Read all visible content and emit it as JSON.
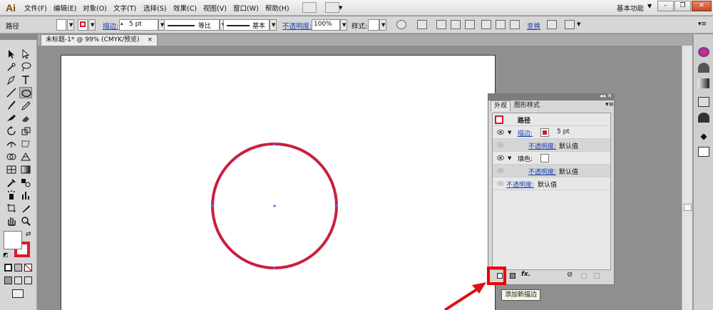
{
  "app": {
    "logo": "Ai"
  },
  "menu": [
    "文件(F)",
    "编辑(E)",
    "对象(O)",
    "文字(T)",
    "选择(S)",
    "效果(C)",
    "视图(V)",
    "窗口(W)",
    "帮助(H)"
  ],
  "workspace": {
    "label": "基本功能"
  },
  "control_bar": {
    "object_type": "路径",
    "stroke_label": "描边:",
    "stroke_value": "5 pt",
    "profile_label": "等比",
    "brush_label": "基本",
    "opacity_label": "不透明度:",
    "opacity_value": "100%",
    "style_label": "样式:",
    "transform_label": "变换"
  },
  "document": {
    "tab_title": "未标题-1* @ 99% (CMYK/预览)"
  },
  "appearance_panel": {
    "tabs": [
      "外观",
      "图形样式"
    ],
    "header": "路径",
    "rows": [
      {
        "label": "描边:",
        "value": "5 pt"
      },
      {
        "label": "不透明度:",
        "value": "默认值"
      },
      {
        "label": "填色:"
      },
      {
        "label": "不透明度:",
        "value": "默认值"
      },
      {
        "label": "不透明度:",
        "value": "默认值"
      }
    ],
    "fx_label": "fx.",
    "tooltip": "添加新描边"
  },
  "colors": {
    "stroke": "#d1182a",
    "circle": "#c8203f",
    "highlight": "#e00000"
  }
}
